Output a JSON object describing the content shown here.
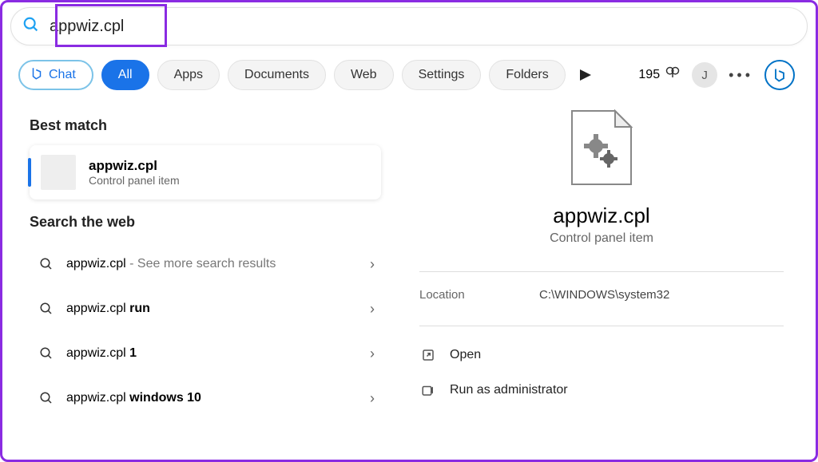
{
  "search": {
    "value": "appwiz.cpl"
  },
  "filters": {
    "chat": "Chat",
    "all": "All",
    "apps": "Apps",
    "documents": "Documents",
    "web": "Web",
    "settings": "Settings",
    "folders": "Folders"
  },
  "rewards": {
    "points": "195"
  },
  "user": {
    "initial": "J"
  },
  "left": {
    "best_match_heading": "Best match",
    "best_match": {
      "title": "appwiz.cpl",
      "subtitle": "Control panel item"
    },
    "search_web_heading": "Search the web",
    "web": [
      {
        "primary": "appwiz.cpl",
        "secondary": " - See more search results"
      },
      {
        "primary": "appwiz.cpl ",
        "bold": "run"
      },
      {
        "primary": "appwiz.cpl ",
        "bold": "1"
      },
      {
        "primary": "appwiz.cpl ",
        "bold": "windows 10"
      }
    ]
  },
  "right": {
    "title": "appwiz.cpl",
    "subtitle": "Control panel item",
    "location_label": "Location",
    "location_value": "C:\\WINDOWS\\system32",
    "actions": {
      "open": "Open",
      "run_admin": "Run as administrator"
    }
  }
}
